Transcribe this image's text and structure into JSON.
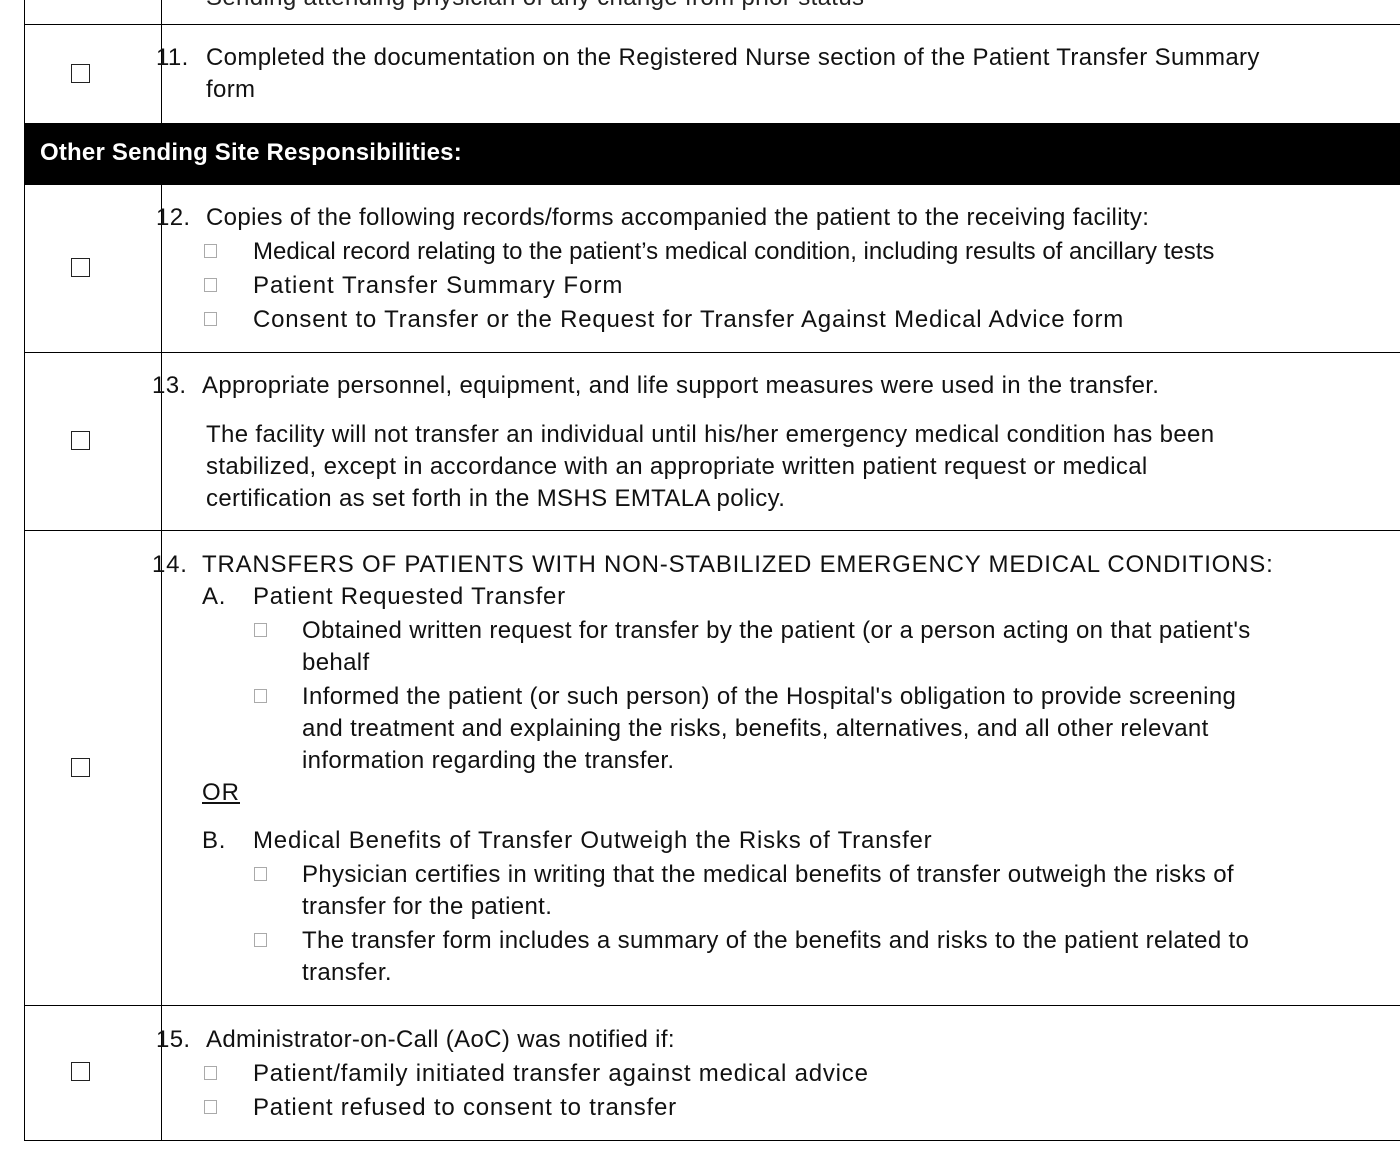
{
  "top_partial_text": "Sending attending physician of any change from prior status",
  "item11": {
    "number": "11.",
    "line1": "Completed the documentation on the Registered Nurse section of the Patient Transfer Summary",
    "line2": "form"
  },
  "section_header": "Other Sending Site Responsibilities:",
  "item12": {
    "number": "12.",
    "text": "Copies of the following records/forms accompanied the patient to the receiving facility:",
    "subitems": [
      "Medical record relating to the patient’s medical condition, including results of ancillary tests",
      "Patient Transfer Summary Form",
      "Consent to Transfer or the Request for Transfer Against Medical Advice form"
    ]
  },
  "item13": {
    "number": "13.",
    "text": "Appropriate personnel, equipment, and life support measures were used in the transfer.",
    "para_lines": [
      "The facility will not transfer an individual until his/her emergency medical condition has been",
      "stabilized, except in accordance with an appropriate written patient request or medical",
      "certification as set forth in the MSHS EMTALA policy."
    ]
  },
  "item14": {
    "number": "14.",
    "text": "TRANSFERS OF PATIENTS WITH NON-STABILIZED EMERGENCY MEDICAL CONDITIONS:",
    "a_label": "A.",
    "a_title": "Patient Requested Transfer",
    "a_sub1_lines": [
      "Obtained written request for transfer by the patient (or a person acting on that patient's",
      "behalf"
    ],
    "a_sub2_lines": [
      "Informed the patient (or such person) of the Hospital's obligation to provide screening",
      "and treatment and explaining the risks, benefits, alternatives, and all other relevant",
      "information regarding the transfer."
    ],
    "or_text": "OR",
    "b_label": "B.",
    "b_title": "Medical Benefits of Transfer Outweigh the Risks of Transfer",
    "b_sub1_lines": [
      "Physician certifies in writing that the medical benefits of transfer outweigh the risks of",
      "transfer for the patient."
    ],
    "b_sub2_lines": [
      "The transfer form includes a summary of the benefits and risks to the patient related to",
      "transfer."
    ]
  },
  "item15": {
    "number": "15.",
    "text": "Administrator-on-Call (AoC) was notified if:",
    "subitems": [
      "Patient/family initiated transfer against medical advice",
      "Patient refused to consent to transfer"
    ]
  }
}
